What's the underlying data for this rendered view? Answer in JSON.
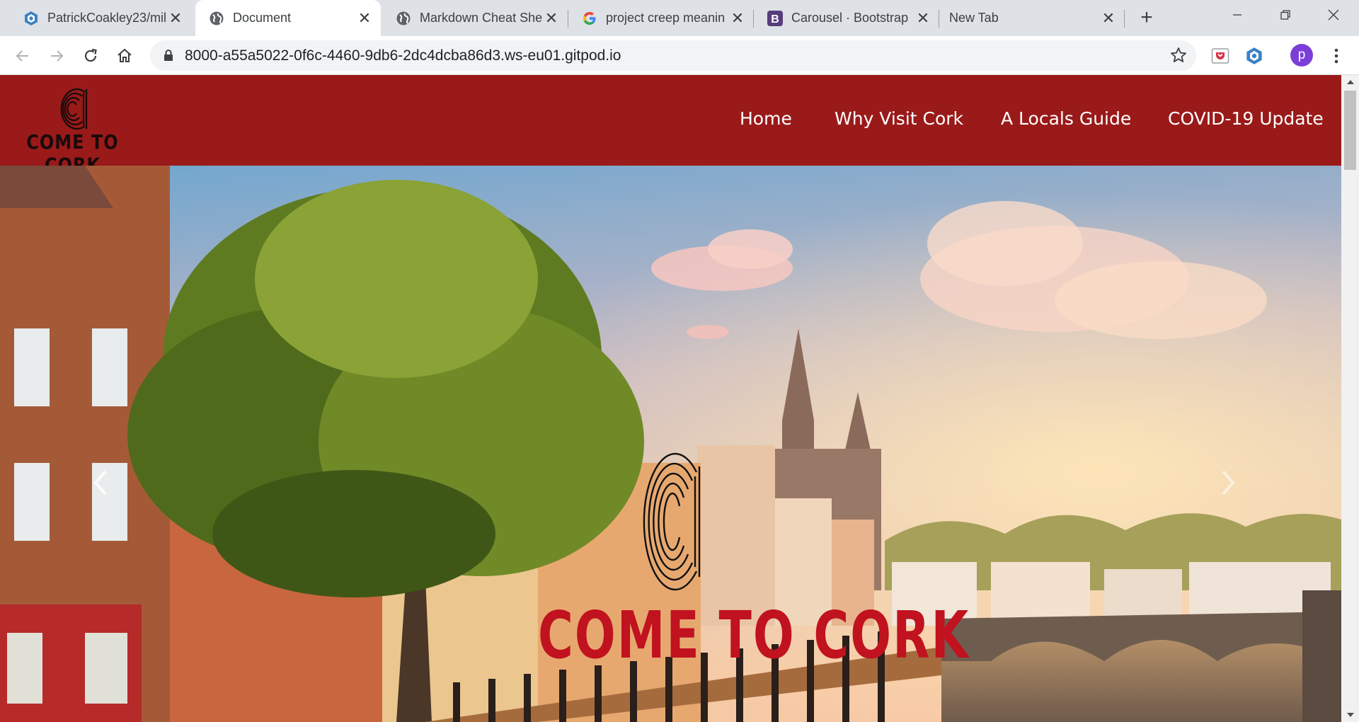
{
  "browser": {
    "tabs": [
      {
        "title": "PatrickCoakley23/mil",
        "icon": "gitpod-icon"
      },
      {
        "title": "Document",
        "icon": "globe-icon"
      },
      {
        "title": "Markdown Cheat She",
        "icon": "globe-icon"
      },
      {
        "title": "project creep meanin",
        "icon": "google-icon"
      },
      {
        "title": "Carousel · Bootstrap",
        "icon": "bootstrap-icon"
      },
      {
        "title": "New Tab",
        "icon": ""
      }
    ],
    "active_tab": "Document",
    "url": "8000-a55a5022-0f6c-4460-9db6-2dc4dcba86d3.ws-eu01.gitpod.io",
    "profile_initial": "p",
    "new_tab_symbol": "+",
    "close_symbol": "✕"
  },
  "site": {
    "brand_text": "COME TO CORK",
    "brand_letter": "C",
    "nav": [
      {
        "label": "Home"
      },
      {
        "label": "Why Visit Cork"
      },
      {
        "label": "A Locals Guide"
      },
      {
        "label": "COVID-19 Update"
      }
    ],
    "hero_title": "COME TO CORK",
    "carousel_prev_icon": "chevron-left-icon",
    "carousel_next_icon": "chevron-right-icon"
  },
  "colors": {
    "navbar": "#9a1a1a",
    "hero_title": "#c1121f",
    "tabstrip": "#dee1e6",
    "avatar": "#7b3fd8"
  }
}
